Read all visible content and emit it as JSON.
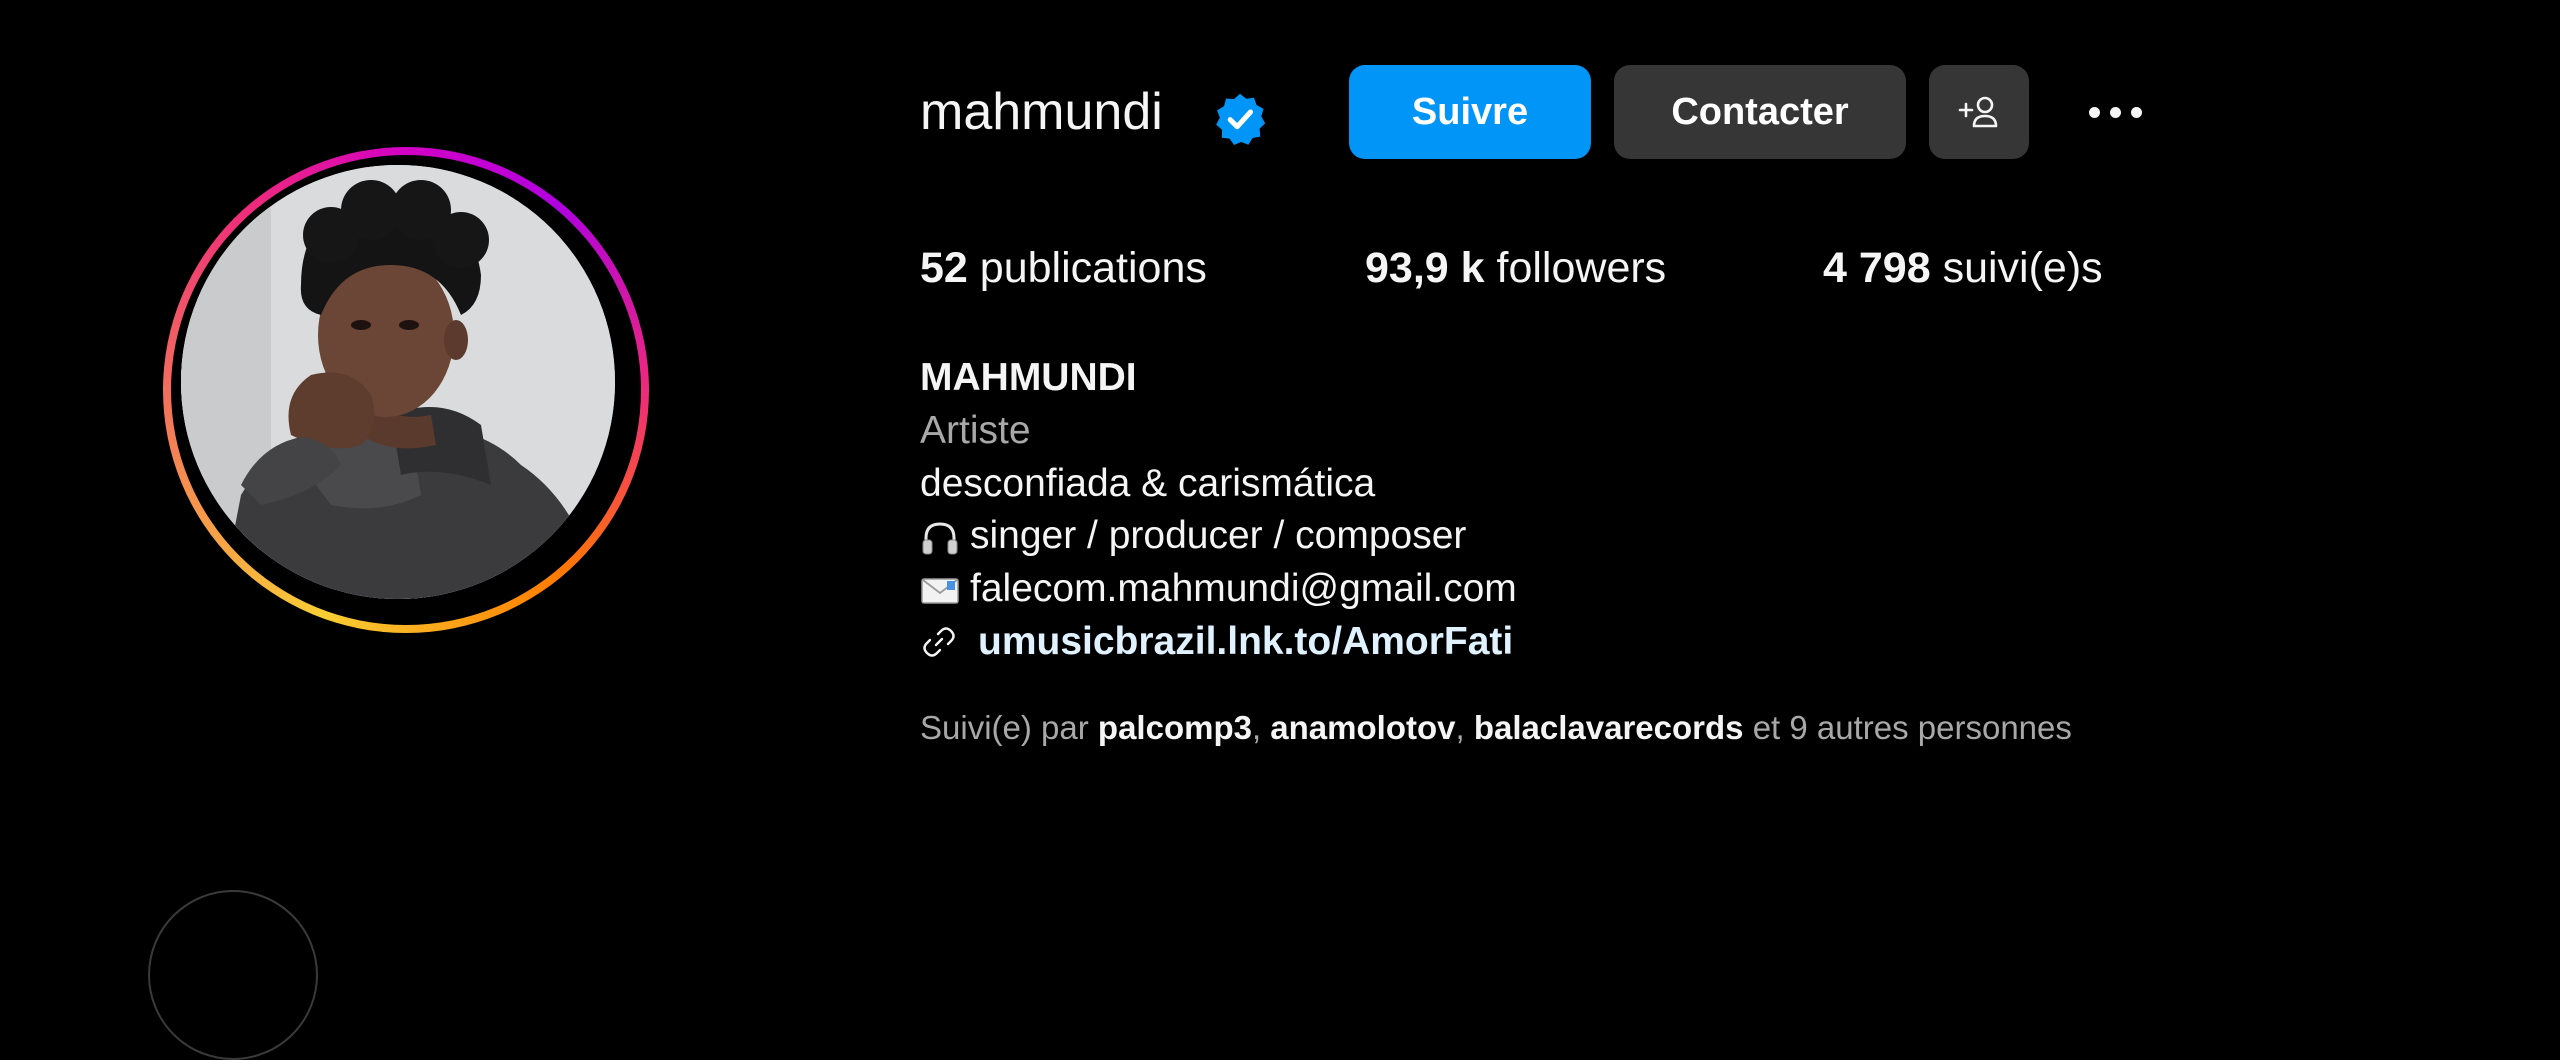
{
  "profile": {
    "username": "mahmundi",
    "display_name": "MAHMUNDI",
    "category": "Artiste",
    "bio": [
      "desconfiada & carismática",
      "singer / producer / composer",
      "falecom.mahmundi@gmail.com"
    ],
    "bio_icons": [
      "headphones-emoji",
      "envelope-emoji"
    ],
    "link": "umusicbrazil.lnk.to/AmorFati",
    "verified": true
  },
  "actions": {
    "follow_label": "Suivre",
    "contact_label": "Contacter"
  },
  "stats": {
    "posts_count": "52",
    "posts_label": "publications",
    "followers_count": "93,9 k",
    "followers_label": "followers",
    "following_count": "4 798",
    "following_label": "suivi(e)s"
  },
  "followed_by": {
    "prefix": "Suivi(e) par",
    "names": [
      "palcomp3",
      "anamolotov",
      "balaclavarecords"
    ],
    "suffix": "et 9 autres personnes"
  },
  "colors": {
    "background": "#000000",
    "primary_button": "#0095f6",
    "secondary_button": "#363636",
    "verified_badge": "#0095f6",
    "muted_text": "#a8a8a8",
    "link_text": "#e0f1ff"
  }
}
